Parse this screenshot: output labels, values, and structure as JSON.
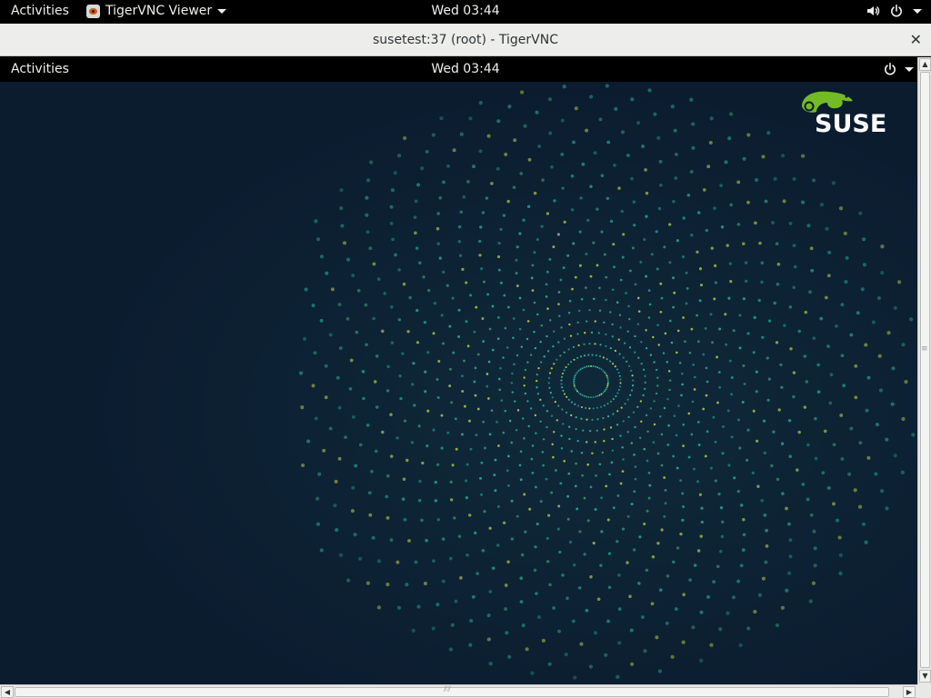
{
  "host_topbar": {
    "activities": "Activities",
    "app_menu": "TigerVNC Viewer",
    "clock": "Wed 03:44",
    "icons": [
      "speaker-icon",
      "power-icon",
      "chevron-down-icon"
    ]
  },
  "vnc_window": {
    "title": "susetest:37 (root) - TigerVNC",
    "close_label": "✕"
  },
  "remote_desktop": {
    "topbar": {
      "activities": "Activities",
      "clock": "Wed 03:44",
      "icons": [
        "power-icon",
        "chevron-down-icon"
      ]
    },
    "wallpaper": {
      "logo": "SUSE",
      "background_color": "#0b1c2f",
      "dot_colors": [
        "#1fb5a0",
        "#2ec4a6",
        "#3ba37c",
        "#c8d94a",
        "#1e8f8c"
      ]
    }
  },
  "scrollbars": {
    "vertical": {
      "up": "▲",
      "down": "▼"
    },
    "horizontal": {
      "left": "◀",
      "right": "▶"
    }
  },
  "colors": {
    "suse_green": "#73ba25",
    "panel_black": "#000000",
    "titlebar": "#ededeb"
  }
}
